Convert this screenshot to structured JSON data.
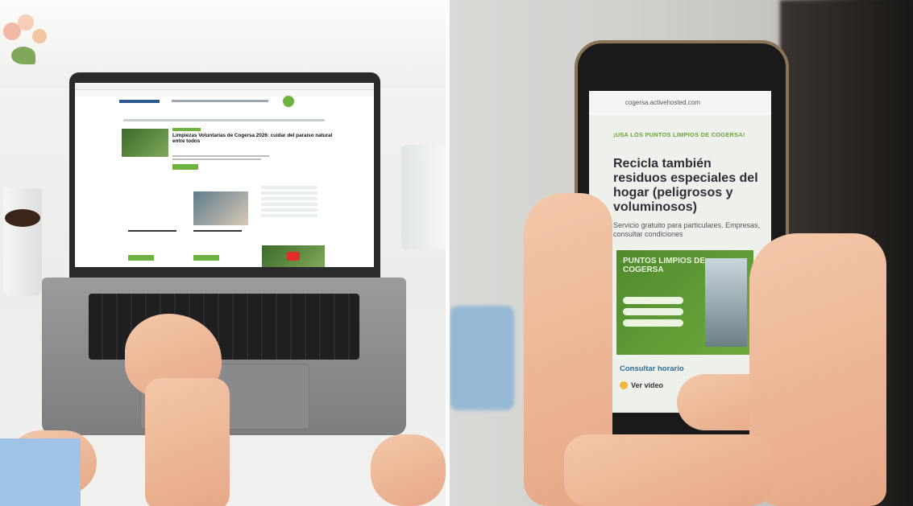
{
  "left_photo": {
    "site": {
      "hero_title": "Limpiezas Voluntarias de Cogersa 2026: cuidar del paraíso natural entre todos",
      "cta_label": "",
      "cards": [
        "",
        ""
      ]
    }
  },
  "right_photo": {
    "phone": {
      "url": "cogersa.activehosted.com",
      "kicker": "¡USA LOS PUNTOS LIMPIOS DE COGERSA!",
      "headline": "Recicla también residuos especiales del hogar (peligrosos y voluminosos)",
      "subhead": "Servicio gratuito para particulares. Empresas, consultar condiciones",
      "banner_title": "PUNTOS LIMPIOS DE COGERSA",
      "link_label": "Consultar horario",
      "video_label": "Ver vídeo"
    }
  },
  "colors": {
    "brand_green": "#6db33f",
    "link_blue": "#2f6d9a",
    "phone_frame": "#8a7356"
  }
}
